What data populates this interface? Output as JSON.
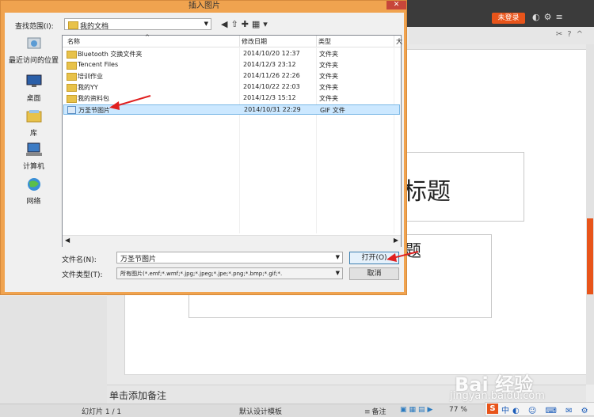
{
  "app": {
    "login_label": "未登录",
    "notes_placeholder": "单击添加备注",
    "title_placeholder": "标题",
    "subtitle_placeholder": "题",
    "status": {
      "slide_info": "幻灯片 1 / 1",
      "template": "默认设计模板",
      "notes": "备注",
      "zoom": "77 %"
    },
    "watermark": "Bai 经验",
    "watermark_url": "jingyan.baidu.com",
    "ime_label": "中"
  },
  "dialog": {
    "title": "插入图片",
    "close_label": "✕",
    "look_in_label": "查找范围(I):",
    "look_in_value": "我的文档",
    "places": [
      {
        "label": "最近访问的位置",
        "icon": "recent-icon"
      },
      {
        "label": "桌面",
        "icon": "desktop-icon"
      },
      {
        "label": "库",
        "icon": "library-icon"
      },
      {
        "label": "计算机",
        "icon": "computer-icon"
      },
      {
        "label": "网络",
        "icon": "network-icon"
      }
    ],
    "columns": [
      "名称",
      "修改日期",
      "类型",
      "大"
    ],
    "files": [
      {
        "name": "Bluetooth 交换文件夹",
        "date": "2014/10/20 12:37",
        "type": "文件夹",
        "icon": "folder-icon"
      },
      {
        "name": "Tencent Files",
        "date": "2014/12/3 23:12",
        "type": "文件夹",
        "icon": "folder-icon"
      },
      {
        "name": "培训作业",
        "date": "2014/11/26 22:26",
        "type": "文件夹",
        "icon": "folder-icon"
      },
      {
        "name": "我的YY",
        "date": "2014/10/22 22:03",
        "type": "文件夹",
        "icon": "folder-icon"
      },
      {
        "name": "我的资料包",
        "date": "2014/12/3 15:12",
        "type": "文件夹",
        "icon": "folder-icon"
      },
      {
        "name": "万圣节图片",
        "date": "2014/10/31 22:29",
        "type": "GIF 文件",
        "icon": "gif-icon",
        "selected": true
      }
    ],
    "file_name_label": "文件名(N):",
    "file_name_value": "万圣节图片",
    "file_type_label": "文件类型(T):",
    "file_type_value": "所有图片(*.emf;*.wmf;*.jpg;*.jpeg;*.jpe;*.png;*.bmp;*.gif;*.",
    "open_label": "打开(O)",
    "cancel_label": "取消"
  },
  "colors": {
    "dialog_frame": "#f0a34f",
    "accent_orange": "#e8541a",
    "selection": "#cce8ff",
    "annotation_red": "#e02020"
  }
}
